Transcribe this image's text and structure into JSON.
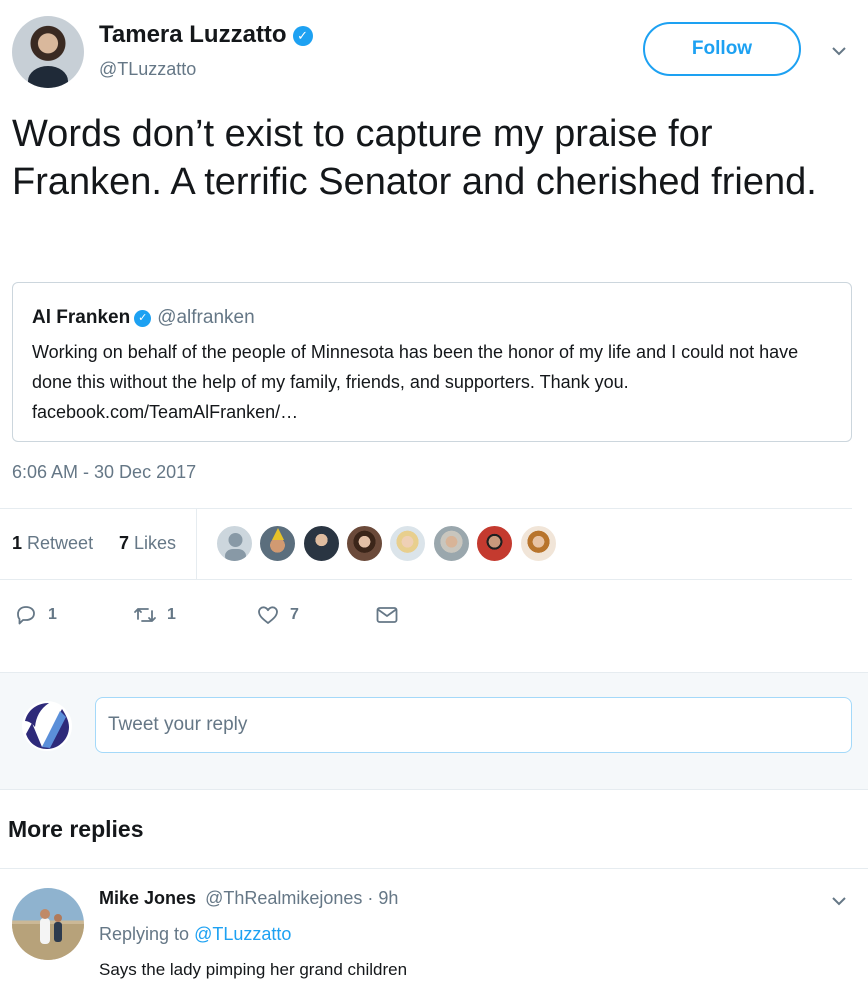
{
  "author": {
    "name": "Tamera Luzzatto",
    "handle": "@TLuzzatto",
    "follow_label": "Follow"
  },
  "tweet": {
    "text": "Words don’t exist to capture my praise for Franken. A terrific Senator and cherished friend.",
    "timestamp": "6:06 AM - 30 Dec 2017"
  },
  "quote": {
    "name": "Al Franken",
    "handle": "@alfranken",
    "text": "Working on behalf of the people of Minnesota has been the honor of my life and I could not have done this without the help of my family, friends, and supporters. Thank you. facebook.com/TeamAlFranken/…"
  },
  "stats": {
    "retweet_count": "1",
    "retweet_label": "Retweet",
    "like_count": "7",
    "like_label": "Likes"
  },
  "actions": {
    "reply_count": "1",
    "retweet_count": "1",
    "like_count": "7"
  },
  "reply_box": {
    "placeholder": "Tweet your reply"
  },
  "more_replies": {
    "heading": "More replies"
  },
  "replies": [
    {
      "name": "Mike Jones",
      "handle": "@ThRealmikejones",
      "time": "· 9h",
      "replying_prefix": "Replying to",
      "replying_to": "@TLuzzatto",
      "text": "Says the lady pimping her grand children"
    }
  ],
  "colors": {
    "accent": "#1da1f2",
    "text": "#14171a",
    "secondary": "#657786",
    "border": "#e6ecf0"
  },
  "icons": {
    "verified": "verified-badge-icon",
    "caret": "chevron-down-icon",
    "reply": "reply-icon",
    "retweet": "retweet-icon",
    "like": "heart-icon",
    "dm": "envelope-icon"
  }
}
